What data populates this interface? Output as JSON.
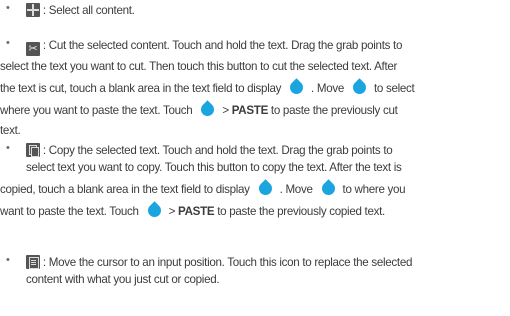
{
  "bullet_char": "•",
  "accent_color": "#1aa5e0",
  "items": [
    {
      "icon": "select-all-icon",
      "lines": [
        {
          "t": ": Select all content."
        }
      ]
    },
    {
      "icon": "cut-icon",
      "icon_glyph": "✂",
      "lines": [
        {
          "t": ": Cut the selected content. Touch and hold the text. Drag the grab points to"
        },
        {
          "t": "select the text you want to cut. Then touch this button to cut the selected text. After"
        },
        {
          "t1": "the text is cut, touch a blank area in the text field to display",
          "t2": ". Move",
          "t3": "to select"
        },
        {
          "t1": "where you want to paste the text. Touch",
          "t2": "> ",
          "b": "PASTE",
          "t3": " to paste the previously cut"
        },
        {
          "t": "text."
        }
      ]
    },
    {
      "icon": "copy-icon",
      "lines": [
        {
          "t": ": Copy the selected text. Touch and hold the text. Drag the grab points to"
        },
        {
          "t": "select text you want to copy. Touch this button to copy the text. After the text is"
        },
        {
          "t1": "copied, touch a blank area in the text field to display",
          "t2": ". Move",
          "t3": "to where you"
        },
        {
          "t1": "want to paste the text. Touch",
          "t2": "> ",
          "b": "PASTE",
          "t3": " to paste the previously copied text."
        }
      ]
    },
    {
      "icon": "paste-icon",
      "lines": [
        {
          "t": ": Move the cursor to an input position. Touch this icon to replace the selected"
        },
        {
          "t": "content with what you just cut or copied."
        }
      ]
    }
  ]
}
